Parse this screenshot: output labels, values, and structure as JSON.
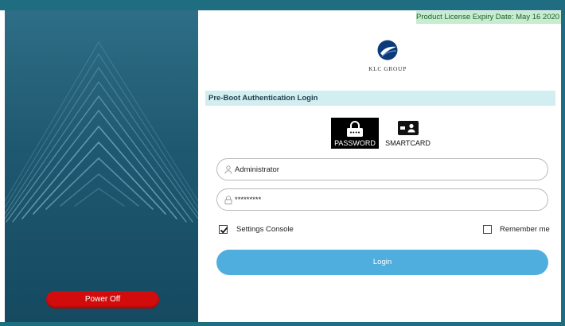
{
  "license": {
    "text": "Product License Expiry Date: May 16 2020"
  },
  "brand": {
    "logo_text": "KLC GROUP",
    "logo_icon": "klc-globe-logo"
  },
  "login": {
    "title": "Pre-Boot Authentication Login",
    "tabs": [
      {
        "label": "PASSWORD",
        "icon": "password-keypad-icon",
        "selected": true
      },
      {
        "label": "SMARTCARD",
        "icon": "smartcard-icon",
        "selected": false
      }
    ],
    "username": {
      "value": "Administrator",
      "icon": "user-icon"
    },
    "password": {
      "value": "*********",
      "icon": "lock-icon"
    },
    "settings_console": {
      "label": "Settings Console",
      "checked": true
    },
    "remember_me": {
      "label": "Remember me",
      "checked": false
    },
    "login_label": "Login"
  },
  "power": {
    "label": "Power Off"
  },
  "colors": {
    "frame": "#1f6d80",
    "panel": "#1e5870",
    "power_button": "#d20c0c",
    "login_button": "#50aedf",
    "title_bar": "#d3eef0",
    "license_bg": "#c7ecd0"
  }
}
